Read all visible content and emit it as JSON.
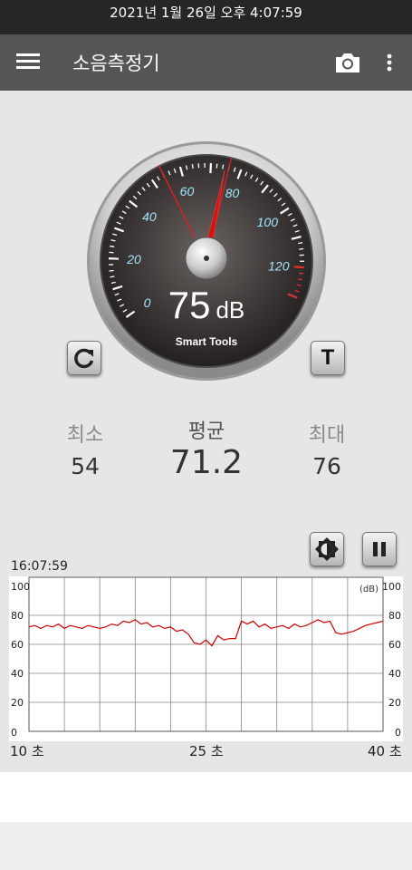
{
  "status_bar": {
    "datetime": "2021년 1월 26일 오후 4:07:59"
  },
  "app_bar": {
    "title": "소음측정기",
    "menu_icon": "hamburger-menu-icon",
    "camera_icon": "camera-icon",
    "more_icon": "more-vert-icon"
  },
  "gauge": {
    "value": 75,
    "reading": "75",
    "unit": "dB",
    "brand": "Smart Tools",
    "scale_labels": [
      "0",
      "20",
      "40",
      "60",
      "80",
      "100",
      "120"
    ],
    "min_marker": 54,
    "max_marker": 76,
    "range": [
      0,
      130
    ]
  },
  "stats": {
    "min_label": "최소",
    "min_value": "54",
    "avg_label": "평균",
    "avg_value": "71.2",
    "max_label": "최대",
    "max_value": "76"
  },
  "graph": {
    "time": "16:07:59",
    "unit_label": "(dB)",
    "x_labels": [
      "10 초",
      "25 초",
      "40 초"
    ],
    "chart_data": {
      "type": "line",
      "title": "",
      "xlabel": "",
      "ylabel": "(dB)",
      "ylim": [
        0,
        100
      ],
      "y_ticks": [
        0,
        20,
        40,
        60,
        80,
        100
      ],
      "xlim": [
        10,
        40
      ],
      "grid": true,
      "series": [
        {
          "color": "#cc0000",
          "x": [
            10,
            10.5,
            11,
            11.5,
            12,
            12.5,
            13,
            13.5,
            14,
            14.5,
            15,
            15.5,
            16,
            16.5,
            17,
            17.5,
            18,
            18.5,
            19,
            19.5,
            20,
            20.5,
            21,
            21.5,
            22,
            22.5,
            23,
            23.5,
            24,
            24.5,
            25,
            25.5,
            26,
            26.5,
            27,
            27.5,
            28,
            28.5,
            29,
            29.5,
            30,
            30.5,
            31,
            31.5,
            32,
            32.5,
            33,
            33.5,
            34,
            34.5,
            35,
            35.5,
            36,
            36.5,
            37,
            37.5,
            38,
            38.5,
            39,
            39.5,
            40
          ],
          "values": [
            72,
            73,
            71,
            73,
            72,
            74,
            71,
            73,
            72,
            71,
            73,
            72,
            71,
            72,
            74,
            73,
            76,
            75,
            77,
            74,
            75,
            72,
            73,
            71,
            72,
            69,
            70,
            67,
            61,
            60,
            63,
            59,
            66,
            63,
            64,
            64,
            76,
            74,
            76,
            72,
            74,
            71,
            72,
            73,
            71,
            74,
            72,
            73,
            75,
            77,
            75,
            76,
            68,
            67,
            68,
            69,
            71,
            73,
            74,
            75,
            76
          ]
        }
      ]
    }
  },
  "controls": {
    "reset_icon": "refresh-icon",
    "t_label": "T",
    "brightness_icon": "brightness-icon",
    "pause_icon": "pause-icon"
  }
}
